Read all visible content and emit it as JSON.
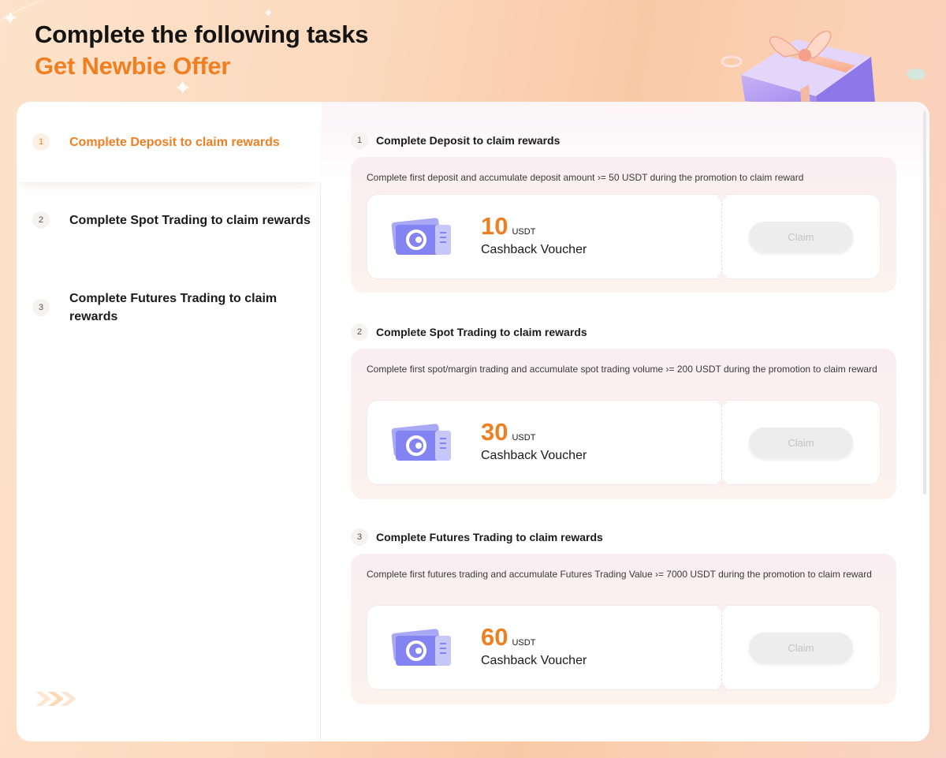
{
  "header": {
    "title": "Complete the following tasks",
    "subtitle": "Get Newbie Offer"
  },
  "sidebar": {
    "items": [
      {
        "num": "1",
        "label": "Complete Deposit to claim rewards"
      },
      {
        "num": "2",
        "label": "Complete Spot Trading to claim rewards"
      },
      {
        "num": "3",
        "label": "Complete Futures Trading to claim rewards"
      }
    ]
  },
  "tasks": [
    {
      "num": "1",
      "title": "Complete Deposit to claim rewards",
      "description": "Complete first deposit and accumulate deposit amount  ›= 50 USDT during the promotion to claim reward",
      "amount": "10",
      "unit": "USDT",
      "voucher_name": "Cashback Voucher",
      "claim_label": "Claim"
    },
    {
      "num": "2",
      "title": "Complete Spot Trading to claim rewards",
      "description": "Complete first spot/margin trading and accumulate spot trading volume  ›= 200 USDT during the promotion to claim reward",
      "amount": "30",
      "unit": "USDT",
      "voucher_name": "Cashback Voucher",
      "claim_label": "Claim"
    },
    {
      "num": "3",
      "title": "Complete Futures Trading to claim rewards",
      "description": "Complete first futures trading and accumulate Futures Trading Value  ›= 7000 USDT during the promotion to claim reward",
      "amount": "60",
      "unit": "USDT",
      "voucher_name": "Cashback Voucher",
      "claim_label": "Claim"
    }
  ],
  "colors": {
    "accent": "#f07f22",
    "ticket": "#7f7ef0",
    "claim_disabled_bg": "#eeeded",
    "claim_disabled_text": "#c3c3c3"
  },
  "icons": {
    "ticket": "cashback-voucher-icon",
    "gift": "gift-box-icon",
    "chevrons": "double-chevron-right-icon"
  }
}
